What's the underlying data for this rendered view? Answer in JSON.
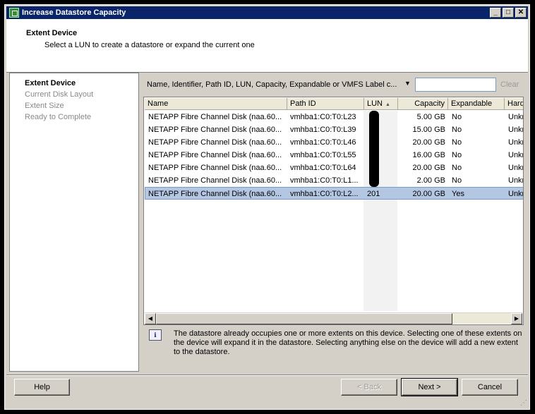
{
  "window": {
    "title": "Increase Datastore Capacity"
  },
  "header": {
    "title": "Extent Device",
    "subtitle": "Select a LUN to create a datastore or expand the current one"
  },
  "steps": [
    "Extent Device",
    "Current Disk Layout",
    "Extent Size",
    "Ready to Complete"
  ],
  "active_step": "Extent Device",
  "filter": {
    "label": "Name, Identifier, Path ID, LUN, Capacity, Expandable or VMFS Label c...",
    "value": "",
    "clear_label": "Clear"
  },
  "table": {
    "columns": [
      "Name",
      "Path ID",
      "LUN",
      "Capacity",
      "Expandable",
      "Hard"
    ],
    "sorted_column": "LUN",
    "rows": [
      {
        "name": "NETAPP Fibre Channel Disk (naa.60...",
        "path": "vmhba1:C0:T0:L23",
        "lun": "",
        "capacity": "5.00 GB",
        "expandable": "No",
        "hard": "Unkr"
      },
      {
        "name": "NETAPP Fibre Channel Disk (naa.60...",
        "path": "vmhba1:C0:T0:L39",
        "lun": "",
        "capacity": "15.00 GB",
        "expandable": "No",
        "hard": "Unkr"
      },
      {
        "name": "NETAPP Fibre Channel Disk (naa.60...",
        "path": "vmhba1:C0:T0:L46",
        "lun": "",
        "capacity": "20.00 GB",
        "expandable": "No",
        "hard": "Unkr"
      },
      {
        "name": "NETAPP Fibre Channel Disk (naa.60...",
        "path": "vmhba1:C0:T0:L55",
        "lun": "",
        "capacity": "16.00 GB",
        "expandable": "No",
        "hard": "Unkr"
      },
      {
        "name": "NETAPP Fibre Channel Disk (naa.60...",
        "path": "vmhba1:C0:T0:L64",
        "lun": "",
        "capacity": "20.00 GB",
        "expandable": "No",
        "hard": "Unkr"
      },
      {
        "name": "NETAPP Fibre Channel Disk (naa.60...",
        "path": "vmhba1:C0:T0:L1...",
        "lun": "",
        "capacity": "2.00 GB",
        "expandable": "No",
        "hard": "Unkr"
      },
      {
        "name": "NETAPP Fibre Channel Disk (naa.60...",
        "path": "vmhba1:C0:T0:L2...",
        "lun": "201",
        "capacity": "20.00 GB",
        "expandable": "Yes",
        "hard": "Unkr"
      }
    ],
    "selected_row": 6
  },
  "info_message": "The datastore already occupies one or more extents on this device. Selecting one of these extents on the device will expand it in the datastore. Selecting anything else on the device will add a new extent to the datastore.",
  "buttons": {
    "help": "Help",
    "back": "< Back",
    "next": "Next >",
    "cancel": "Cancel"
  }
}
